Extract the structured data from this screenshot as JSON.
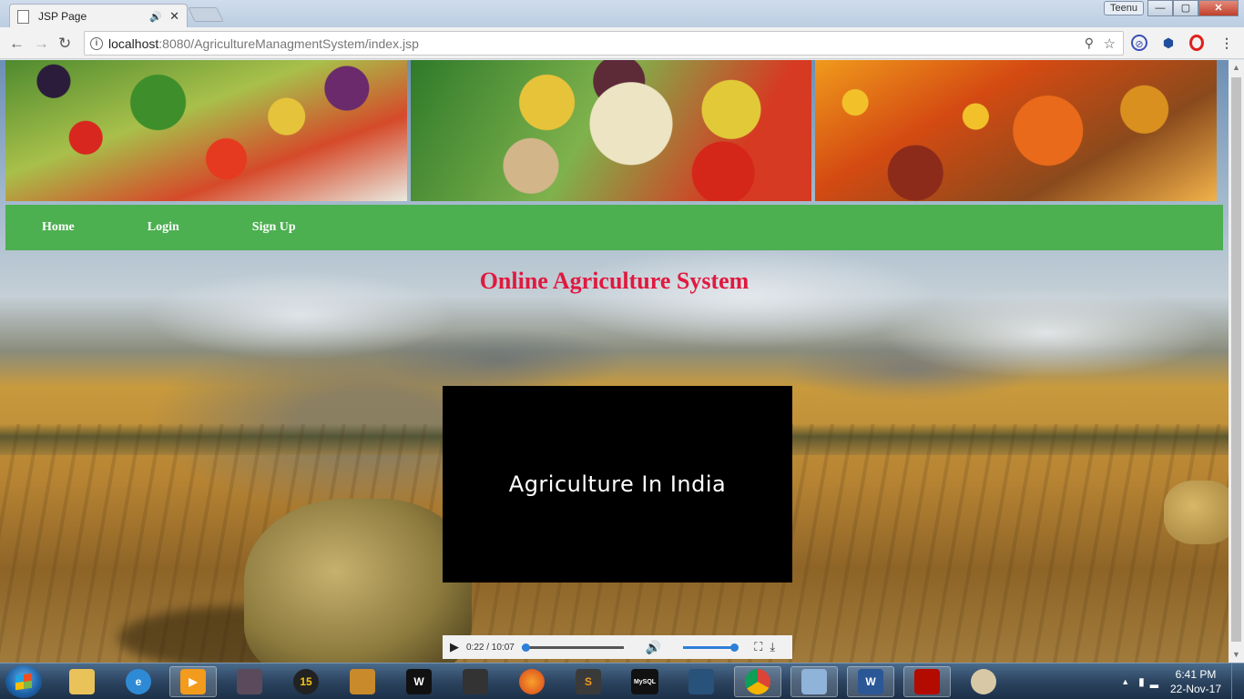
{
  "browser": {
    "tab_title": "JSP Page",
    "tab_audio_icon": "speaker-icon",
    "tab_close": "✕",
    "user_name": "Teenu",
    "window_buttons": {
      "minimize": "—",
      "maximize": "▢",
      "close": "✕"
    },
    "url_host": "localhost",
    "url_rest": ":8080/AgricultureManagmentSystem/index.jsp",
    "nav": {
      "back": "←",
      "forward": "→",
      "reload": "↻"
    }
  },
  "page": {
    "nav_items": [
      {
        "label": "Home"
      },
      {
        "label": "Login"
      },
      {
        "label": "Sign Up"
      }
    ],
    "title": "Online Agriculture System",
    "title_color": "#e0193f",
    "nav_color": "#4caf50",
    "video": {
      "caption": "Agriculture In India",
      "time": "0:22 / 10:07",
      "progress": 0.036,
      "volume": 1.0
    }
  },
  "taskbar": {
    "apps": [
      {
        "name": "explorer",
        "icon": "folder-icon"
      },
      {
        "name": "internet-explorer",
        "icon": "ie-icon"
      },
      {
        "name": "media-player",
        "icon": "media-player-icon"
      },
      {
        "name": "game",
        "icon": "game-icon"
      },
      {
        "name": "app-15",
        "label": "15",
        "icon": "badge-15-icon"
      },
      {
        "name": "counter-strike",
        "icon": "cs-icon"
      },
      {
        "name": "wwe",
        "label": "W",
        "icon": "wwe-icon"
      },
      {
        "name": "sleeping-dogs",
        "icon": "sleeping-dogs-icon"
      },
      {
        "name": "firefox",
        "icon": "firefox-icon"
      },
      {
        "name": "sublime",
        "label": "S",
        "icon": "sublime-icon"
      },
      {
        "name": "mysql",
        "label": "MySQL",
        "icon": "mysql-icon"
      },
      {
        "name": "mysql-workbench",
        "icon": "dolphin-icon"
      },
      {
        "name": "chrome",
        "icon": "chrome-icon"
      },
      {
        "name": "virtualbox",
        "icon": "cube-icon"
      },
      {
        "name": "word",
        "label": "W",
        "icon": "word-icon"
      },
      {
        "name": "acrobat",
        "icon": "pdf-icon"
      },
      {
        "name": "paint",
        "icon": "palette-icon"
      }
    ],
    "time": "6:41 PM",
    "date": "22-Nov-17"
  }
}
